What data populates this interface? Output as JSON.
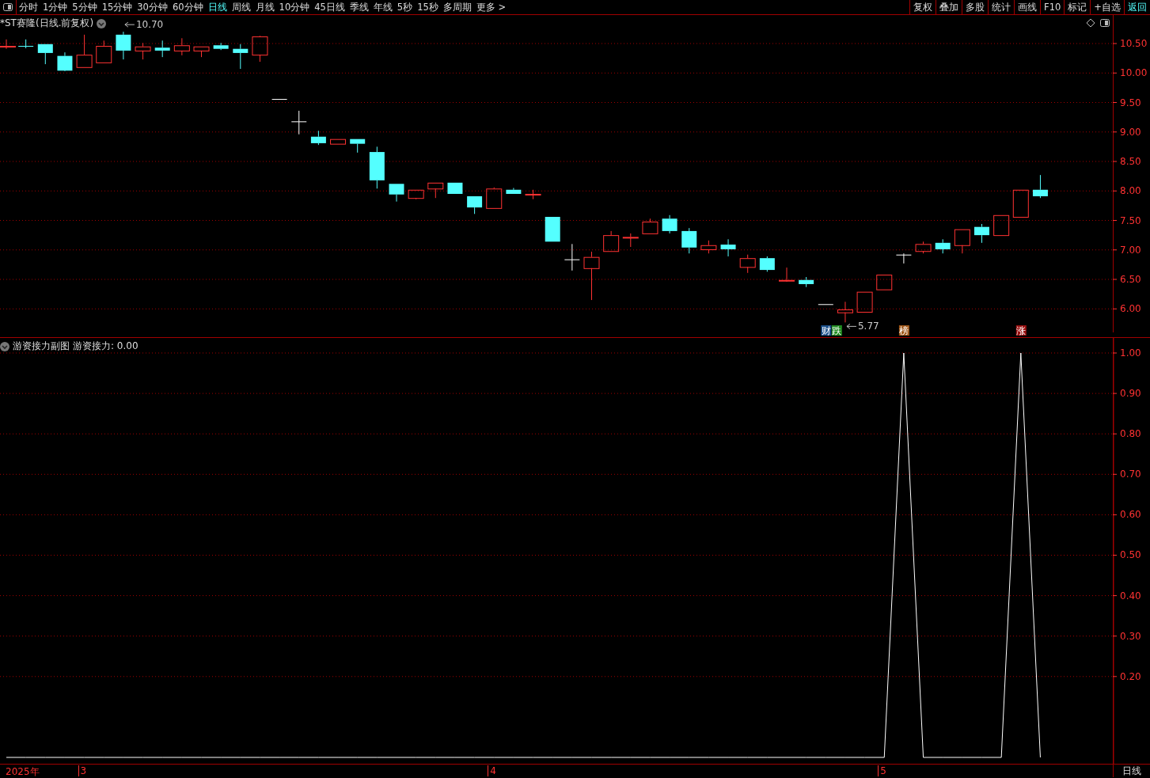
{
  "toolbar": {
    "periods": [
      {
        "label": "分时",
        "selected": false
      },
      {
        "label": "1分钟",
        "selected": false
      },
      {
        "label": "5分钟",
        "selected": false
      },
      {
        "label": "15分钟",
        "selected": false
      },
      {
        "label": "30分钟",
        "selected": false
      },
      {
        "label": "60分钟",
        "selected": false
      },
      {
        "label": "日线",
        "selected": true
      },
      {
        "label": "周线",
        "selected": false
      },
      {
        "label": "月线",
        "selected": false
      },
      {
        "label": "10分钟",
        "selected": false
      },
      {
        "label": "45日线",
        "selected": false
      },
      {
        "label": "季线",
        "selected": false
      },
      {
        "label": "年线",
        "selected": false
      },
      {
        "label": "5秒",
        "selected": false
      },
      {
        "label": "15秒",
        "selected": false
      },
      {
        "label": "多周期",
        "selected": false
      },
      {
        "label": "更多 >",
        "selected": false
      }
    ],
    "actions": [
      {
        "label": "复权",
        "selected": false
      },
      {
        "label": "叠加",
        "selected": false
      },
      {
        "label": "多股",
        "selected": false
      },
      {
        "label": "统计",
        "selected": false
      },
      {
        "label": "画线",
        "selected": false
      },
      {
        "label": "F10",
        "selected": false
      },
      {
        "label": "标记",
        "selected": false
      },
      {
        "label": "+自选",
        "selected": false
      },
      {
        "label": "返回",
        "selected": true
      }
    ]
  },
  "price_pane": {
    "title": "*ST赛隆(日线.前复权)",
    "axis_ticks": [
      "10.50",
      "10.00",
      "9.50",
      "9.00",
      "8.50",
      "8.00",
      "7.50",
      "7.00",
      "6.50",
      "6.00"
    ],
    "price_marks": [
      "10.70",
      "5.77"
    ],
    "badges": [
      {
        "text": "财",
        "color": "#1a4f8a"
      },
      {
        "text": "跌",
        "color": "#1f8a1f"
      },
      {
        "text": "榜",
        "color": "#a0581a"
      },
      {
        "text": "涨",
        "color": "#9a1010"
      }
    ]
  },
  "indicator_pane": {
    "title": "游资接力副图",
    "reading": "游资接力: 0.00",
    "chart_data": {
      "type": "line",
      "grid": true,
      "categories": [
        null,
        null,
        null,
        null,
        null,
        null,
        null,
        null,
        null,
        null,
        null,
        null,
        null,
        null,
        null,
        null,
        null,
        null,
        null,
        null,
        null,
        null,
        null,
        null,
        null,
        null,
        null,
        null,
        null,
        null,
        null,
        null,
        null,
        null,
        null,
        null,
        null,
        null,
        null,
        null,
        null,
        null,
        null,
        null,
        null,
        null,
        null,
        null,
        null,
        null,
        null,
        null,
        null,
        null
      ],
      "ylim": [
        -0.0157,
        1.0372
      ],
      "yticks": [
        {
          "value": 0.2,
          "label": "0.20"
        },
        {
          "value": 0.3,
          "label": "0.30"
        },
        {
          "value": 0.4,
          "label": "0.40"
        },
        {
          "value": 0.5,
          "label": "0.50"
        },
        {
          "value": 0.6,
          "label": "0.60"
        },
        {
          "value": 0.7,
          "label": "0.70"
        },
        {
          "value": 0.8,
          "label": "0.80"
        },
        {
          "value": 0.9,
          "label": "0.90"
        },
        {
          "value": 1,
          "label": "1.00"
        }
      ],
      "series": [
        {
          "color": "#ffffff",
          "values": [
            0,
            0,
            0,
            0,
            0,
            0,
            0,
            0,
            0,
            0,
            0,
            0,
            0,
            0,
            0,
            0,
            0,
            0,
            0,
            0,
            0,
            0,
            0,
            0,
            0,
            0,
            0,
            0,
            0,
            0,
            0,
            0,
            0,
            0,
            0,
            0,
            0,
            0,
            0,
            0,
            0,
            0,
            0,
            0,
            0,
            0,
            1,
            0,
            0,
            0,
            0,
            0,
            1,
            0
          ]
        }
      ]
    }
  },
  "time_axis": {
    "labels": [
      "2025年",
      "3",
      "4",
      "5"
    ],
    "period": "日线"
  }
}
